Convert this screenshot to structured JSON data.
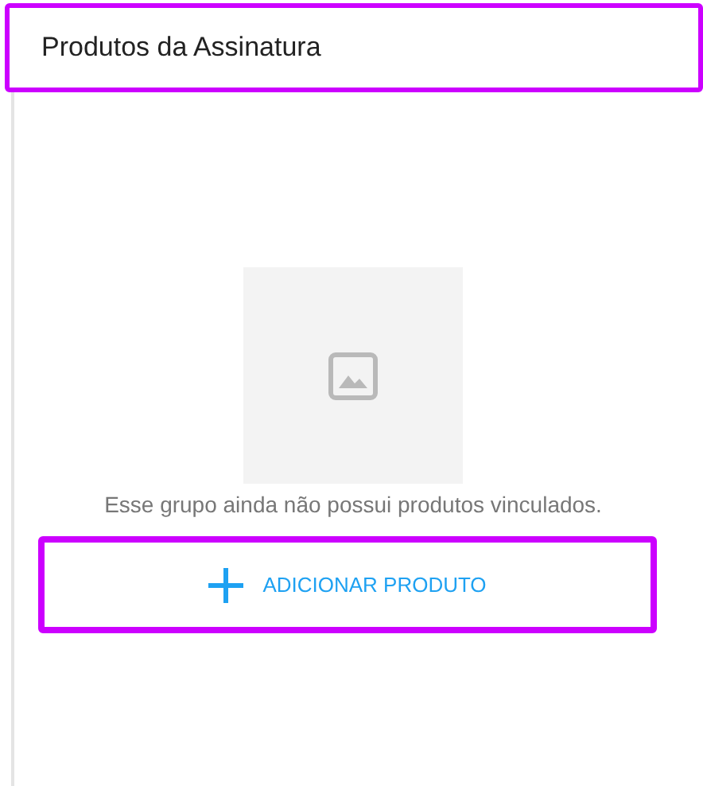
{
  "header": {
    "title": "Produtos da Assinatura"
  },
  "empty_state": {
    "message": "Esse grupo ainda não possui produtos vinculados."
  },
  "add_button": {
    "label": "ADICIONAR PRODUTO"
  }
}
